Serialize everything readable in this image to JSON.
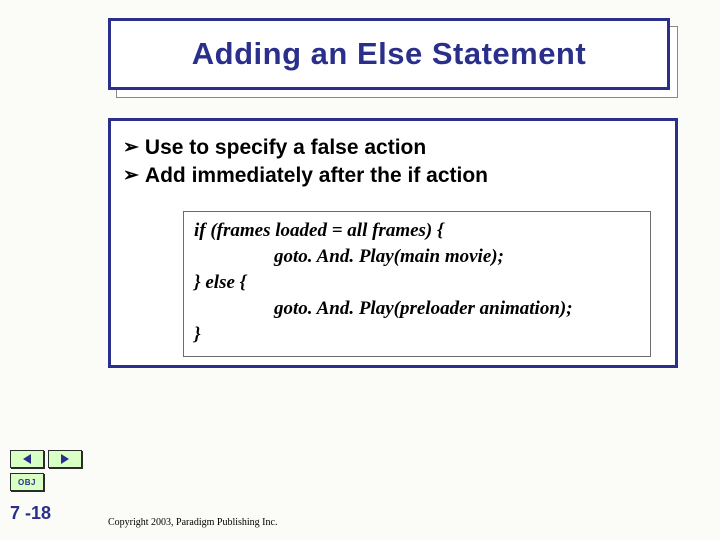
{
  "title": "Adding an Else Statement",
  "bullets": [
    "Use to specify a false action",
    "Add immediately after the if action"
  ],
  "code": {
    "l1": "if (frames loaded = all frames) {",
    "l2": "goto. And. Play(main movie);",
    "l3": "} else {",
    "l4": "goto. And. Play(preloader animation);",
    "l5": "}"
  },
  "nav": {
    "obj_label": "OBJ"
  },
  "page_number": "7 -18",
  "copyright": "Copyright 2003, Paradigm Publishing Inc."
}
